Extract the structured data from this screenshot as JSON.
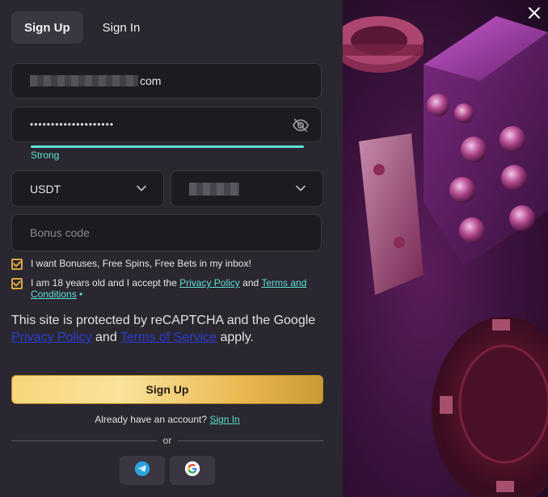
{
  "tabs": {
    "signup": "Sign Up",
    "signin": "Sign In"
  },
  "form": {
    "email_suffix": "com",
    "password_masked": "••••••••••••••••••••",
    "strength": "Strong",
    "currency": "USDT",
    "bonus_placeholder": "Bonus code"
  },
  "checks": {
    "bonuses": "I want Bonuses, Free Spins, Free Bets in my inbox!",
    "age_prefix": "I am 18 years old and I accept the",
    "privacy_policy": "Privacy Policy",
    "and": "and",
    "terms": "Terms and Conditions",
    "required_mark": "•"
  },
  "recaptcha": {
    "text1": "This site is protected by reCAPTCHA and the Google",
    "privacy": "Privacy Policy",
    "and": "and",
    "terms": "Terms of Service",
    "apply": "apply."
  },
  "buttons": {
    "signup": "Sign Up"
  },
  "footer": {
    "already": "Already have an account?",
    "signin_link": "Sign In",
    "or": "or"
  },
  "icons": {
    "eye": "eye-slash-icon",
    "telegram": "telegram-icon",
    "google": "google-icon",
    "close": "close-icon",
    "chevron": "chevron-down-icon"
  },
  "colors": {
    "accent_teal": "#5ee0d3",
    "checkbox_gold": "#d9a640",
    "button_gold": "#f8d57b",
    "link_blue": "#2a3dd6"
  }
}
